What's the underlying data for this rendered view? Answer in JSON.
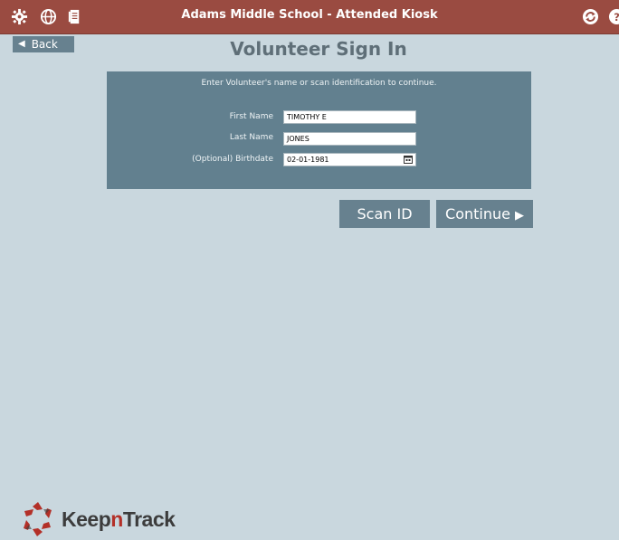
{
  "header": {
    "title": "Adams Middle School - Attended Kiosk",
    "left_icons": [
      "settings-icon",
      "globe-icon",
      "document-icon"
    ],
    "right_icons": [
      "refresh-icon",
      "help-icon"
    ]
  },
  "nav": {
    "back_label": "Back"
  },
  "page": {
    "title": "Volunteer Sign In"
  },
  "form": {
    "instructions": "Enter Volunteer's name or scan identification to continue.",
    "first_name": {
      "label": "First Name",
      "value": "TIMOTHY E"
    },
    "last_name": {
      "label": "Last Name",
      "value": "JONES"
    },
    "birthdate": {
      "label": "(Optional) Birthdate",
      "value": "02-01-1981"
    }
  },
  "actions": {
    "scan_label": "Scan ID",
    "continue_label": "Continue"
  },
  "brand": {
    "prefix": "Keep",
    "middle": "n",
    "suffix": "Track"
  },
  "colors": {
    "topbar": "#9a4b41",
    "background": "#c9d7de",
    "panel": "#62808f",
    "button": "#67818f",
    "brand_red": "#b33028"
  }
}
